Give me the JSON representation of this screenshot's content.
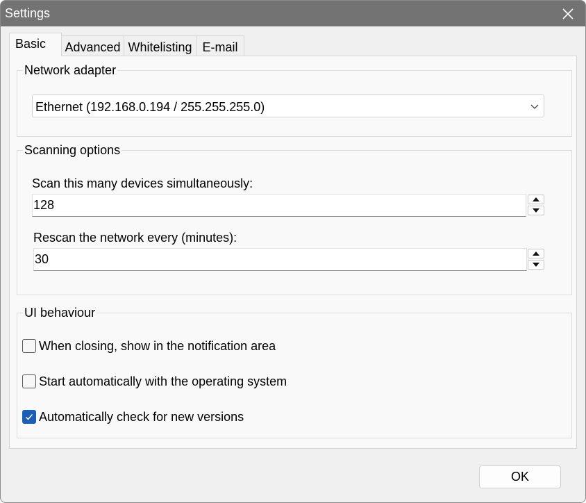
{
  "window": {
    "title": "Settings",
    "titlebar_color": "#737373",
    "close_icon": "close-icon"
  },
  "tabs": [
    {
      "label": "Basic",
      "active": true
    },
    {
      "label": "Advanced",
      "active": false
    },
    {
      "label": "Whitelisting",
      "active": false
    },
    {
      "label": "E-mail",
      "active": false
    }
  ],
  "network_adapter": {
    "label": "Network adapter",
    "selected": "Ethernet (192.168.0.194 / 255.255.255.0)",
    "dropdown_icon": "chevron-down-icon"
  },
  "scanning": {
    "label": "Scanning options",
    "simultaneous_label": "Scan this many devices simultaneously:",
    "simultaneous_value": "128",
    "rescan_label": "Rescan the network every (minutes):",
    "rescan_value": "30"
  },
  "ui_behaviour": {
    "label": "UI behaviour",
    "options": [
      {
        "label": "When closing, show in the notification area",
        "checked": false
      },
      {
        "label": "Start automatically with the operating system",
        "checked": false
      },
      {
        "label": "Automatically check for new versions",
        "checked": true
      }
    ],
    "checked_color": "#1a5fb4"
  },
  "buttons": {
    "ok_label": "OK"
  }
}
